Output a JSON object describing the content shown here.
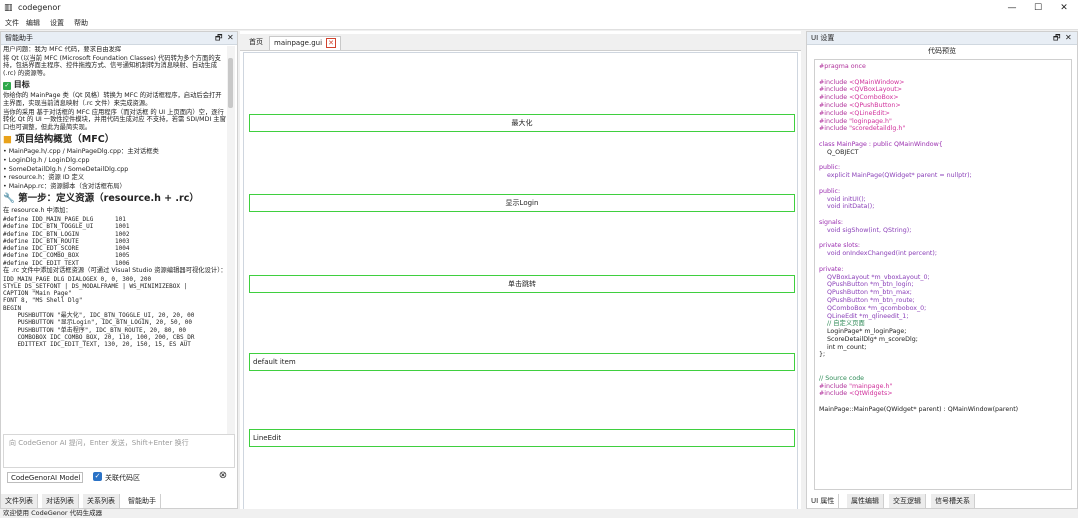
{
  "window": {
    "title": "codegenor",
    "min": "—",
    "max": "☐",
    "close": "✕",
    "icon": "app-icon"
  },
  "menu": [
    "文件",
    "编辑",
    "设置",
    "帮助"
  ],
  "left_panel": {
    "title": "智能助手",
    "float_btn": "🗗",
    "close_btn": "✕",
    "chat": {
      "p1": "用户问题：我为 MFC 代码，要求自由发挥",
      "p2": "将 Qt (以当前 MFC (Microsoft Foundation Classes) 代码转为多个方面的支持，包括界面主程序、控件拖拽方式、信号通知机制转为消息映射、自动生成 (.rc) 的资源等。",
      "goal_title": "目标",
      "goal_p1": "你给你的 MainPage 类（Qt 风格）转换为 MFC 的对话框程序，启动后会打开主界面，实现当前消息映射（.rc 文件）来完成资源。",
      "goal_p2": "当你的采用 基于对话框的 MFC 应用程序（而对话框 的 UI 上页面内）空，逐行转化 Qt 的 UI 一致性控件模块，并用代码生成对应 不支持，若需 SDI/MDI 主窗口也可调整，但此为最简实现。",
      "section1": "项目结构概览（MFC）",
      "files": [
        "• MainPage.h/.cpp / MainPageDlg.cpp：主对话框类",
        "• LoginDlg.h / LoginDlg.cpp",
        "• SomeDetailDlg.h / SomeDetailDlg.cpp",
        "• resource.h：资源 ID 定义",
        "• MainApp.rc：资源脚本（含对话框布局）"
      ],
      "section2": "第一步：定义资源（resource.h + .rc）",
      "res_intro": "在 resource.h 中添加：",
      "defines": "#define IDD_MAIN_PAGE_DLG      101\n#define IDC_BTN_TOGGLE_UI      1001\n#define IDC_BTN_LOGIN          1002\n#define IDC_BTN_ROUTE          1003\n#define IDC_EDT_SCORE          1004\n#define IDC_COMBO_BOX          1005\n#define IDC_EDIT_TEXT          1006",
      "rc_intro": "在 .rc 文件中添加对话框资源（可通过 Visual Studio 资源编辑器可视化设计）：",
      "rc_code": "IDD_MAIN_PAGE DLG DIALOGEX 0, 0, 300, 200\nSTYLE DS_SETFONT | DS_MODALFRAME | WS_MINIMIZEBOX |\nCAPTION \"Main Page\"\nFONT 8, \"MS Shell Dlg\"\nBEGIN\n    PUSHBUTTON \"最大化\", IDC_BTN_TOGGLE_UI, 20, 20, 00\n    PUSHBUTTON \"显示Login\", IDC_BTN_LOGIN, 20, 50, 00\n    PUSHBUTTON \"单击程序\", IDC_BTN_ROUTE, 20, 80, 00\n    COMBOBOX IDC_COMBO_BOX, 20, 110, 100, 200, CBS_DR\n    EDITTEXT IDC_EDIT_TEXT, 130, 20, 150, 15, ES AUT"
    },
    "input_placeholder": "向 CodeGenor AI 提问，Enter 发送，Shift+Enter 换行",
    "model": "CodeGenorAI Model",
    "ctx_label": "关联代码区",
    "send_icon": "⊗",
    "tabs": [
      "文件列表",
      "对话列表",
      "关系列表",
      "智能助手"
    ]
  },
  "center": {
    "tab_home": "首页",
    "tab_main": "mainpage.gui",
    "tab_close": "✕",
    "widgets": [
      {
        "label": "最大化"
      },
      {
        "label": "显示Login"
      },
      {
        "label": "单击跳转"
      },
      {
        "label": "default item"
      },
      {
        "label": "LineEdit"
      }
    ]
  },
  "right_panel": {
    "title": "UI 设置",
    "float_btn": "🗗",
    "close_btn": "✕",
    "code_label": "代码预览",
    "code": "#pragma once\n\n#include <QMainWindow>\n#include <QVBoxLayout>\n#include <QComboBox>\n#include <QPushButton>\n#include <QLineEdit>\n#include \"loginpage.h\"\n#include \"scoredetaildlg.h\"\n\nclass MainPage : public QMainWindow{\n    Q_OBJECT\n\npublic:\n    explicit MainPage(QWidget* parent = nullptr);\n\npublic:\n    void initUI();\n    void initData();\n\nsignals:\n    void sigShow(int, QString);\n\nprivate slots:\n    void onIndexChanged(int percent);\n\nprivate:\n    QVBoxLayout *m_vboxLayout_0;\n    QPushButton *m_btn_login;\n    QPushButton *m_btn_max;\n    QPushButton *m_btn_route;\n    QComboBox *m_qcombobox_0;\n    QLineEdit *m_qlineedit_1;\n    // 自定义页面\n    LoginPage* m_loginPage;\n    ScoreDetailDlg* m_scoreDlg;\n    int m_count;\n};\n\n\n// Source code\n#include \"mainpage.h\"\n#include <QtWidgets>\n\nMainPage::MainPage(QWidget* parent) : QMainWindow(parent)",
    "tabs": [
      "UI 属性",
      "属性编辑",
      "交互逻辑",
      "信号槽关系"
    ]
  },
  "status": "欢迎使用 CodeGenor 代码生成器"
}
